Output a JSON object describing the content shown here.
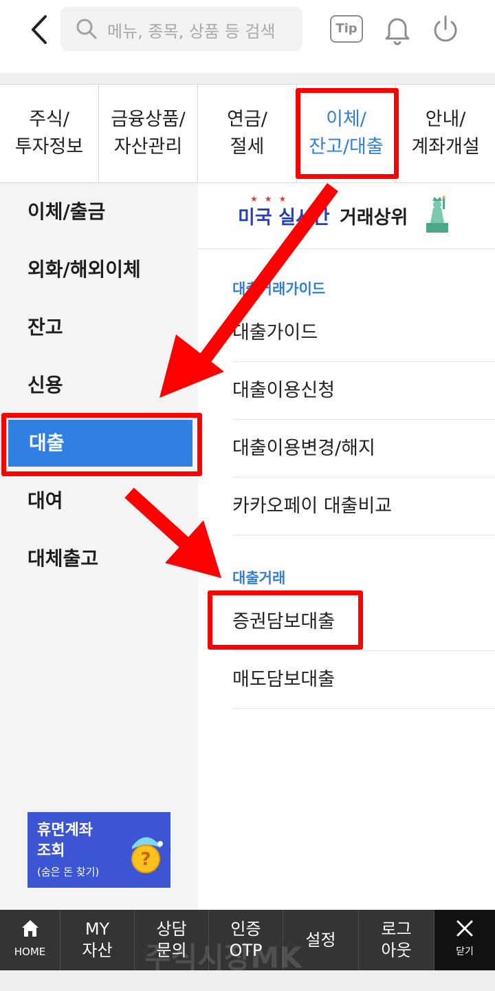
{
  "header": {
    "search_placeholder": "메뉴, 종목, 상품 등 검색",
    "tip_label": "Tip"
  },
  "tabs": [
    {
      "line1": "주식/",
      "line2": "투자정보",
      "active": false
    },
    {
      "line1": "금융상품/",
      "line2": "자산관리",
      "active": false
    },
    {
      "line1": "연금/",
      "line2": "절세",
      "active": false
    },
    {
      "line1": "이체/",
      "line2": "잔고/대출",
      "active": true
    },
    {
      "line1": "안내/",
      "line2": "계좌개설",
      "active": false
    }
  ],
  "left_menu": {
    "items": [
      "이체/출금",
      "외화/해외이체",
      "잔고",
      "신용",
      "대출",
      "대여",
      "대체출고"
    ],
    "active_index": 4,
    "banner": {
      "title_line1": "휴면계좌",
      "title_line2": "조회",
      "subtitle": "(숨은 돈 찾기)"
    }
  },
  "right_panel": {
    "promo_left": "미국 실시간",
    "promo_right": "거래상위",
    "sections": [
      {
        "label": "대출거래가이드",
        "items": [
          "대출가이드",
          "대출이용신청",
          "대출이용변경/해지",
          "카카오페이 대출비교"
        ]
      },
      {
        "label": "대출거래",
        "items": [
          "증권담보대출",
          "매도담보대출"
        ]
      }
    ]
  },
  "bottom_nav": {
    "home": "HOME",
    "items": [
      {
        "line1": "MY",
        "line2": "자산"
      },
      {
        "line1": "상담",
        "line2": "문의"
      },
      {
        "line1": "인증",
        "line2": "OTP"
      },
      {
        "line1": "설정",
        "line2": ""
      },
      {
        "line1": "로그",
        "line2": "아웃"
      }
    ],
    "close": "닫기"
  },
  "watermark": "주식시장MK",
  "colors": {
    "accent_blue": "#2f80e2",
    "annotation_red": "#ff0000",
    "nav_bg": "#333436",
    "banner_bg": "#3c55d2"
  }
}
